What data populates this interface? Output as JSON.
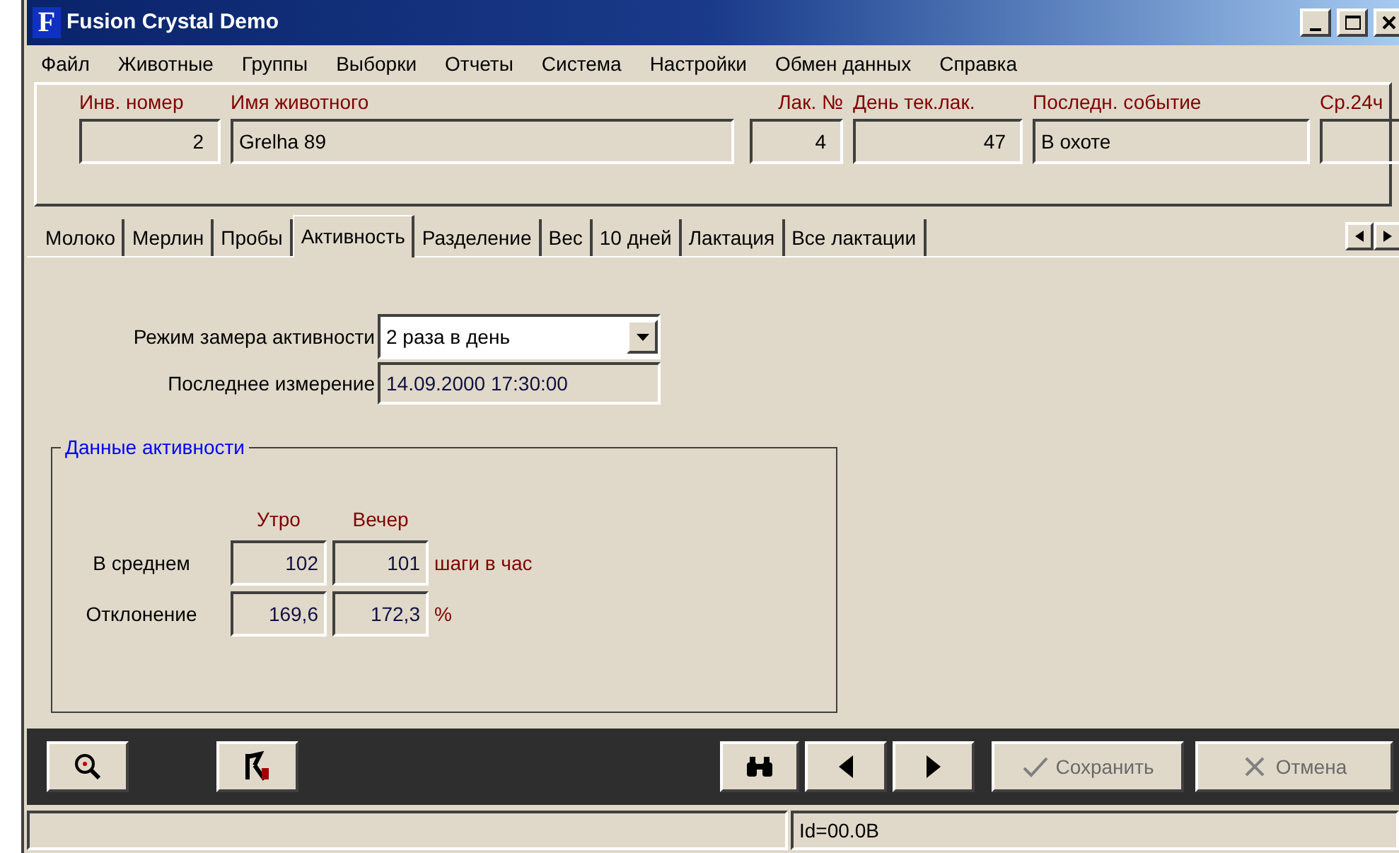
{
  "window": {
    "title": "Fusion Crystal Demo",
    "logo": "F"
  },
  "menu": [
    "Файл",
    "Животные",
    "Группы",
    "Выборки",
    "Отчеты",
    "Система",
    "Настройки",
    "Обмен данных",
    "Справка"
  ],
  "header_fields": [
    {
      "label": "Инв. номер",
      "value": "2",
      "kind": "number"
    },
    {
      "label": "Имя животного",
      "value": "Grelha 89",
      "kind": "text"
    },
    {
      "label": "Лак. №",
      "value": "4",
      "kind": "number"
    },
    {
      "label": "День тек.лак.",
      "value": "47",
      "kind": "number"
    },
    {
      "label": "Последн. событие",
      "value": "В охоте",
      "kind": "text"
    },
    {
      "label": "Ср.24ч",
      "kind": "number"
    }
  ],
  "tabs": [
    {
      "label": "Молоко",
      "selected": false
    },
    {
      "label": "Мерлин",
      "selected": false
    },
    {
      "label": "Пробы",
      "selected": false
    },
    {
      "label": "Активность",
      "selected": true
    },
    {
      "label": "Разделение",
      "selected": false
    },
    {
      "label": "Вес",
      "selected": false
    },
    {
      "label": "10 дней",
      "selected": false
    },
    {
      "label": "Лактация",
      "selected": false
    },
    {
      "label": "Все лактации",
      "selected": false
    }
  ],
  "measure_mode": {
    "label": "Режим замера активности",
    "value": "2 раза в день"
  },
  "last_measurement": {
    "label": "Последнее измерение",
    "value": "14.09.2000 17:30:00"
  },
  "activity_group": {
    "title": "Данные активности",
    "columns": [
      "Утро",
      "Вечер"
    ],
    "rows": [
      {
        "label": "В среднем",
        "values": [
          "102",
          "101"
        ],
        "unit": "шаги в час"
      },
      {
        "label": "Отклонение",
        "values": [
          "169,6",
          "172,3"
        ],
        "unit": "%"
      }
    ]
  },
  "toolbar": {
    "save": {
      "label": "Сохранить",
      "disabled": true
    },
    "cancel": {
      "label": "Отмена",
      "disabled": true
    }
  },
  "status_bar": {
    "id": "Id=00.0B"
  }
}
